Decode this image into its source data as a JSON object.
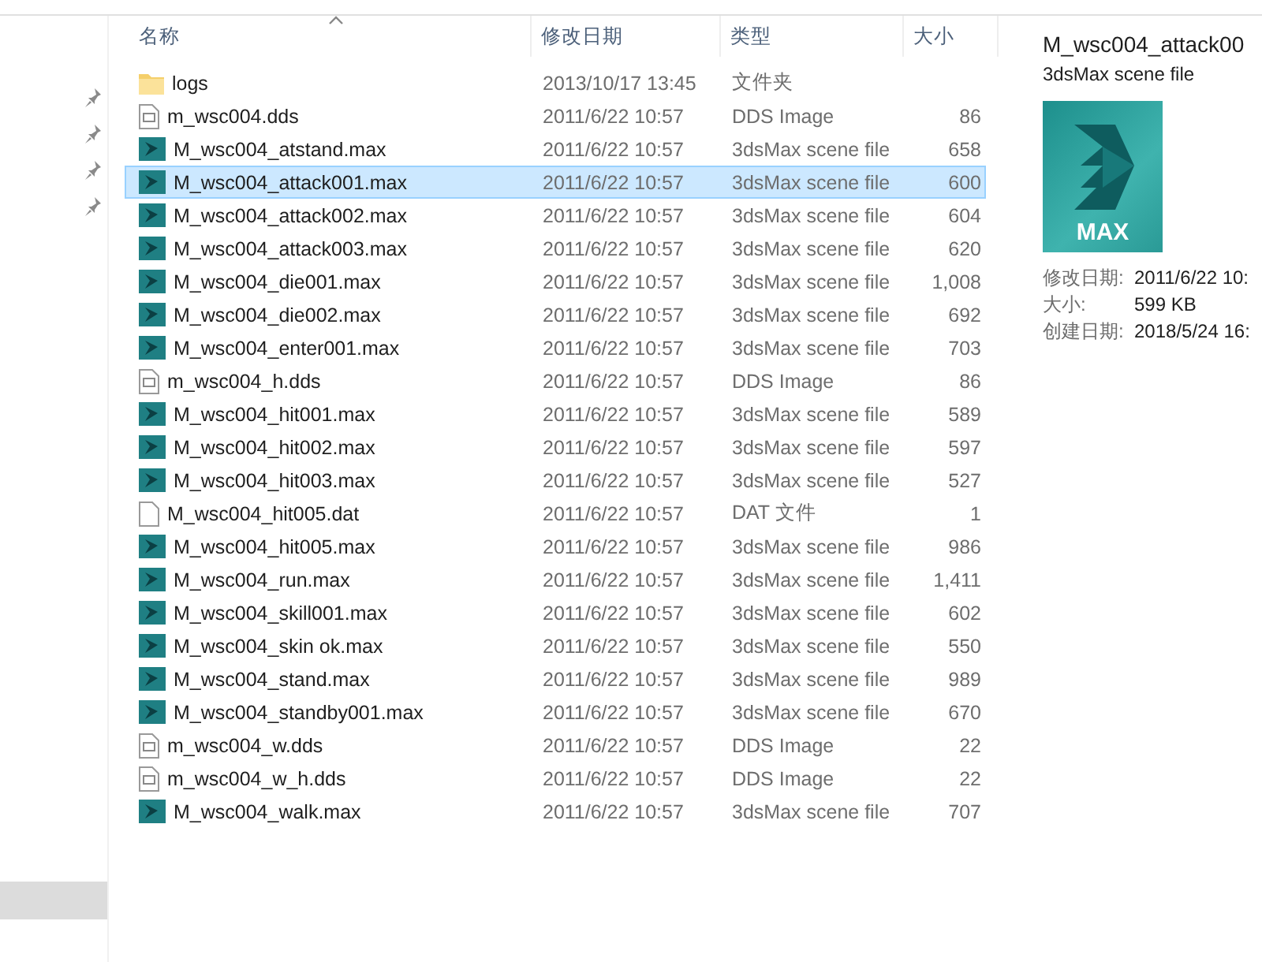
{
  "columns": [
    {
      "label": "名称",
      "sorted": true
    },
    {
      "label": "修改日期",
      "sorted": false
    },
    {
      "label": "类型",
      "sorted": false
    },
    {
      "label": "大小",
      "sorted": false
    }
  ],
  "files": [
    {
      "kind": "folder",
      "name": "logs",
      "date": "2013/10/17 13:45",
      "type": "文件夹",
      "selected": false
    },
    {
      "kind": "dds",
      "name": "m_wsc004.dds",
      "date": "2011/6/22 10:57",
      "type": "DDS Image",
      "size": "86",
      "selected": false
    },
    {
      "kind": "max",
      "name": "M_wsc004_atstand.max",
      "date": "2011/6/22 10:57",
      "type": "3dsMax scene file",
      "size": "658",
      "selected": false
    },
    {
      "kind": "max",
      "name": "M_wsc004_attack001.max",
      "date": "2011/6/22 10:57",
      "type": "3dsMax scene file",
      "size": "600",
      "selected": true
    },
    {
      "kind": "max",
      "name": "M_wsc004_attack002.max",
      "date": "2011/6/22 10:57",
      "type": "3dsMax scene file",
      "size": "604",
      "selected": false
    },
    {
      "kind": "max",
      "name": "M_wsc004_attack003.max",
      "date": "2011/6/22 10:57",
      "type": "3dsMax scene file",
      "size": "620",
      "selected": false
    },
    {
      "kind": "max",
      "name": "M_wsc004_die001.max",
      "date": "2011/6/22 10:57",
      "type": "3dsMax scene file",
      "size": "1,008",
      "selected": false
    },
    {
      "kind": "max",
      "name": "M_wsc004_die002.max",
      "date": "2011/6/22 10:57",
      "type": "3dsMax scene file",
      "size": "692",
      "selected": false
    },
    {
      "kind": "max",
      "name": "M_wsc004_enter001.max",
      "date": "2011/6/22 10:57",
      "type": "3dsMax scene file",
      "size": "703",
      "selected": false
    },
    {
      "kind": "dds",
      "name": "m_wsc004_h.dds",
      "date": "2011/6/22 10:57",
      "type": "DDS Image",
      "size": "86",
      "selected": false
    },
    {
      "kind": "max",
      "name": "M_wsc004_hit001.max",
      "date": "2011/6/22 10:57",
      "type": "3dsMax scene file",
      "size": "589",
      "selected": false
    },
    {
      "kind": "max",
      "name": "M_wsc004_hit002.max",
      "date": "2011/6/22 10:57",
      "type": "3dsMax scene file",
      "size": "597",
      "selected": false
    },
    {
      "kind": "max",
      "name": "M_wsc004_hit003.max",
      "date": "2011/6/22 10:57",
      "type": "3dsMax scene file",
      "size": "527",
      "selected": false
    },
    {
      "kind": "dat",
      "name": "M_wsc004_hit005.dat",
      "date": "2011/6/22 10:57",
      "type": "DAT 文件",
      "size": "1",
      "selected": false
    },
    {
      "kind": "max",
      "name": "M_wsc004_hit005.max",
      "date": "2011/6/22 10:57",
      "type": "3dsMax scene file",
      "size": "986",
      "selected": false
    },
    {
      "kind": "max",
      "name": "M_wsc004_run.max",
      "date": "2011/6/22 10:57",
      "type": "3dsMax scene file",
      "size": "1,411",
      "selected": false
    },
    {
      "kind": "max",
      "name": "M_wsc004_skill001.max",
      "date": "2011/6/22 10:57",
      "type": "3dsMax scene file",
      "size": "602",
      "selected": false
    },
    {
      "kind": "max",
      "name": "M_wsc004_skin ok.max",
      "date": "2011/6/22 10:57",
      "type": "3dsMax scene file",
      "size": "550",
      "selected": false
    },
    {
      "kind": "max",
      "name": "M_wsc004_stand.max",
      "date": "2011/6/22 10:57",
      "type": "3dsMax scene file",
      "size": "989",
      "selected": false
    },
    {
      "kind": "max",
      "name": "M_wsc004_standby001.max",
      "date": "2011/6/22 10:57",
      "type": "3dsMax scene file",
      "size": "670",
      "selected": false
    },
    {
      "kind": "dds",
      "name": "m_wsc004_w.dds",
      "date": "2011/6/22 10:57",
      "type": "DDS Image",
      "size": "22",
      "selected": false
    },
    {
      "kind": "dds",
      "name": "m_wsc004_w_h.dds",
      "date": "2011/6/22 10:57",
      "type": "DDS Image",
      "size": "22",
      "selected": false
    },
    {
      "kind": "max",
      "name": "M_wsc004_walk.max",
      "date": "2011/6/22 10:57",
      "type": "3dsMax scene file",
      "size": "707",
      "selected": false
    }
  ],
  "preview": {
    "title": "M_wsc004_attack00",
    "subtitle": "3dsMax scene file",
    "thumbnail_label": "MAX",
    "details": [
      {
        "label": "修改日期:",
        "value": "2011/6/22 10:"
      },
      {
        "label": "大小:",
        "value": "599 KB"
      },
      {
        "label": "创建日期:",
        "value": "2018/5/24 16:"
      }
    ]
  }
}
